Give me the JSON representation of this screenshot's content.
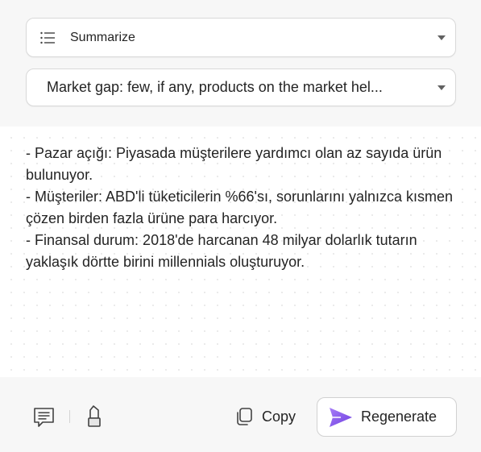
{
  "mode_select": {
    "icon": "list-icon",
    "selected": "Summarize"
  },
  "topic_select": {
    "selected": "Market gap: few, if any, products on the market hel..."
  },
  "output": {
    "lines": [
      "- Pazar açığı: Piyasada müşterilere yardımcı olan az sayıda ürün bulunuyor.",
      "- Müşteriler: ABD'li tüketicilerin %66'sı, sorunlarını yalnızca kısmen çözen birden fazla ürüne para harcıyor.",
      "- Finansal durum: 2018'de harcanan 48 milyar dolarlık tutarın yaklaşık dörtte birini millennials oluşturuyor."
    ]
  },
  "toolbar": {
    "feedback_icon": "comment-icon",
    "highlight_icon": "highlighter-icon",
    "copy_icon": "copy-icon",
    "copy_label": "Copy",
    "regenerate_icon": "send-icon",
    "regenerate_label": "Regenerate"
  },
  "colors": {
    "accent": "#8a5cf6",
    "background": "#f7f7f7",
    "surface": "#ffffff",
    "text": "#242424"
  }
}
